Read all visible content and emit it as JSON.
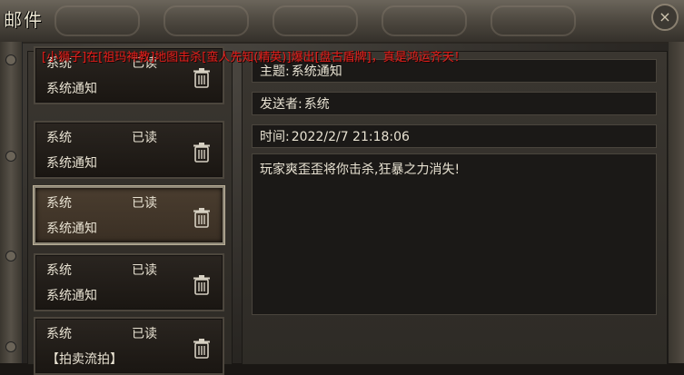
{
  "window": {
    "title": "邮件",
    "close_glyph": "×"
  },
  "broadcast": "[小狮子]在[祖玛神教]地图击杀[蛮人先知(精英)]爆出[盘古盾牌]，真是鸿运齐天！",
  "mail_list": [
    {
      "sender": "系统",
      "status": "已读",
      "subject": "系统通知",
      "selected": false
    },
    {
      "sender": "系统",
      "status": "已读",
      "subject": "系统通知",
      "selected": false
    },
    {
      "sender": "系统",
      "status": "已读",
      "subject": "系统通知",
      "selected": true
    },
    {
      "sender": "系统",
      "status": "已读",
      "subject": "系统通知",
      "selected": false
    },
    {
      "sender": "系统",
      "status": "已读",
      "subject": "【拍卖流拍】",
      "selected": false
    }
  ],
  "detail": {
    "subject_label": "主题:",
    "subject_value": "系统通知",
    "sender_label": "发送者:",
    "sender_value": "系统",
    "time_label": "时间:",
    "time_value": "2022/2/7 21:18:06",
    "body": "玩家爽歪歪将你击杀,狂暴之力消失!"
  },
  "colors": {
    "broadcast": "#e0201c",
    "text": "#e8e2d2"
  },
  "icons": {
    "delete": "trash-icon"
  }
}
